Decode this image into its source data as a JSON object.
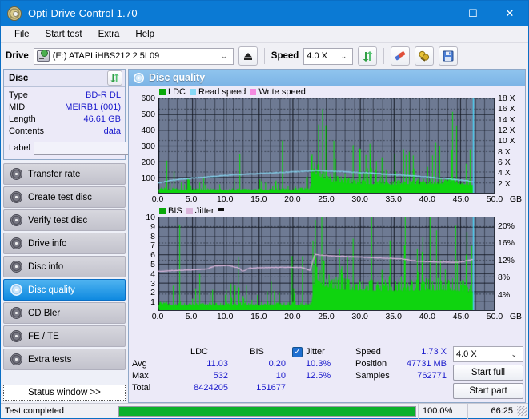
{
  "window": {
    "title": "Opti Drive Control 1.70",
    "icon": "disc-icon",
    "minimize": "—",
    "maximize": "☐",
    "close": "✕"
  },
  "menu": {
    "items": [
      {
        "label": "File",
        "accel": "F"
      },
      {
        "label": "Start test",
        "accel": "S"
      },
      {
        "label": "Extra",
        "accel": "x"
      },
      {
        "label": "Help",
        "accel": "H"
      }
    ]
  },
  "toolbar": {
    "drive_label": "Drive",
    "drive_value": "(E:)  ATAPI iHBS212  2 5L09",
    "eject_icon": "eject-icon",
    "speed_label": "Speed",
    "speed_value": "4.0 X",
    "refresh_icon": "refresh-icon",
    "eraser_icon": "eraser-icon",
    "clamp_icon": "clamp-icon",
    "save_icon": "save-icon",
    "chevron": "⌄"
  },
  "sidebar": {
    "disc_panel": {
      "title": "Disc",
      "refresh_icon": "refresh-icon",
      "rows": [
        {
          "key": "Type",
          "value": "BD-R DL"
        },
        {
          "key": "MID",
          "value": "MEIRB1 (001)"
        },
        {
          "key": "Length",
          "value": "46.61 GB"
        },
        {
          "key": "Contents",
          "value": "data"
        }
      ],
      "label_key": "Label",
      "label_value": "",
      "label_placeholder": "",
      "cd_icon": "cd-icon"
    },
    "nav": [
      {
        "label": "Transfer rate",
        "icon": "disc-icon",
        "active": false
      },
      {
        "label": "Create test disc",
        "icon": "disc-icon",
        "active": false
      },
      {
        "label": "Verify test disc",
        "icon": "disc-icon",
        "active": false
      },
      {
        "label": "Drive info",
        "icon": "disc-icon",
        "active": false
      },
      {
        "label": "Disc info",
        "icon": "disc-icon",
        "active": false
      },
      {
        "label": "Disc quality",
        "icon": "disc-icon",
        "active": true
      },
      {
        "label": "CD Bler",
        "icon": "disc-icon",
        "active": false
      },
      {
        "label": "FE / TE",
        "icon": "disc-icon",
        "active": false
      },
      {
        "label": "Extra tests",
        "icon": "disc-icon",
        "active": false
      }
    ],
    "status_window_button": "Status window >>"
  },
  "main": {
    "title": "Disc quality",
    "title_icon": "disc-icon"
  },
  "stats": {
    "col_headers": [
      "LDC",
      "BIS"
    ],
    "rows": [
      {
        "label": "Avg",
        "ldc": "11.03",
        "bis": "0.20"
      },
      {
        "label": "Max",
        "ldc": "532",
        "bis": "10"
      },
      {
        "label": "Total",
        "ldc": "8424205",
        "bis": "151677"
      }
    ],
    "jitter": {
      "checked": true,
      "check_glyph": "✓",
      "label": "Jitter",
      "values": [
        "10.3%",
        "12.5%"
      ]
    },
    "info": [
      {
        "key": "Speed",
        "value": "1.73 X"
      },
      {
        "key": "Position",
        "value": "47731 MB"
      },
      {
        "key": "Samples",
        "value": "762771"
      }
    ],
    "speed_select": "4.0 X",
    "speed_chevron": "⌄",
    "start_full_button": "Start full",
    "start_part_button": "Start part"
  },
  "statusbar": {
    "text": "Test completed",
    "progress_percent": 100.0,
    "progress_label": "100.0%",
    "elapsed": "66:25",
    "progress_color": "#0ab02a"
  },
  "colors": {
    "accent": "#0b7ad4",
    "plot_bg": "#6e7a93",
    "ldc_green": "#0fd40f",
    "read_speed": "#87d9f5",
    "write_speed": "#f58ae0",
    "jitter_pink": "#dcb6dc",
    "value_blue": "#1a1acc"
  },
  "chart_data": [
    {
      "type": "bar",
      "name": "ldc-chart",
      "title": "",
      "xlabel": "GB",
      "ylabel": "LDC",
      "xlim": [
        0,
        50
      ],
      "ylim": [
        0,
        600
      ],
      "y2lim": [
        0,
        18
      ],
      "y2label": "X",
      "grid": true,
      "legend": [
        {
          "label": "LDC",
          "color": "#0aa80a",
          "type": "bar"
        },
        {
          "label": "Read speed",
          "color": "#87d9f5",
          "type": "line"
        },
        {
          "label": "Write speed",
          "color": "#f58ae0",
          "type": "line"
        }
      ],
      "xticks": [
        "0.0",
        "5.0",
        "10.0",
        "15.0",
        "20.0",
        "25.0",
        "30.0",
        "35.0",
        "40.0",
        "45.0",
        "50.0"
      ],
      "yticks": [
        "100",
        "200",
        "300",
        "400",
        "500",
        "600"
      ],
      "y2ticks": [
        "2 X",
        "4 X",
        "6 X",
        "8 X",
        "10 X",
        "12 X",
        "14 X",
        "16 X",
        "18 X"
      ],
      "data_end_x": 46.8,
      "series": [
        {
          "name": "LDC",
          "color": "#0fd40f",
          "type": "bar",
          "x_start": 0.1,
          "x_end": 46.8,
          "baseline": [
            {
              "x": 0.1,
              "y": 35
            },
            {
              "x": 3,
              "y": 30
            },
            {
              "x": 8,
              "y": 28
            },
            {
              "x": 14,
              "y": 26
            },
            {
              "x": 20,
              "y": 30
            },
            {
              "x": 22.5,
              "y": 35
            },
            {
              "x": 23.2,
              "y": 200
            },
            {
              "x": 24.5,
              "y": 150
            },
            {
              "x": 26,
              "y": 110
            },
            {
              "x": 30,
              "y": 90
            },
            {
              "x": 35,
              "y": 85
            },
            {
              "x": 40,
              "y": 90
            },
            {
              "x": 44,
              "y": 95
            },
            {
              "x": 46.8,
              "y": 80
            }
          ],
          "spike_density": 0.55,
          "peak_max": 532
        },
        {
          "name": "Read speed",
          "color": "#87d9f5",
          "type": "line",
          "points": [
            {
              "x": 0.2,
              "y2": 1.9
            },
            {
              "x": 2,
              "y2": 2.4
            },
            {
              "x": 5,
              "y2": 2.8
            },
            {
              "x": 8,
              "y2": 3.1
            },
            {
              "x": 11,
              "y2": 3.4
            },
            {
              "x": 14,
              "y2": 3.6
            },
            {
              "x": 17,
              "y2": 3.8
            },
            {
              "x": 20,
              "y2": 4.0
            },
            {
              "x": 22.5,
              "y2": 4.15
            },
            {
              "x": 23.2,
              "y2": 4.3
            },
            {
              "x": 25,
              "y2": 4.2
            },
            {
              "x": 28,
              "y2": 4.0
            },
            {
              "x": 31,
              "y2": 3.8
            },
            {
              "x": 34,
              "y2": 3.55
            },
            {
              "x": 37,
              "y2": 3.3
            },
            {
              "x": 40,
              "y2": 3.0
            },
            {
              "x": 43,
              "y2": 2.7
            },
            {
              "x": 46,
              "y2": 2.3
            },
            {
              "x": 46.8,
              "y2": 2.1
            }
          ]
        },
        {
          "name": "Write speed",
          "color": "#f58ae0",
          "type": "line",
          "points": []
        }
      ],
      "cursor_x": 46.9
    },
    {
      "type": "bar",
      "name": "bis-chart",
      "title": "",
      "xlabel": "GB",
      "ylabel": "BIS",
      "xlim": [
        0,
        50
      ],
      "ylim": [
        0,
        10
      ],
      "y2lim": [
        0,
        22
      ],
      "y2label": "%",
      "grid": true,
      "legend": [
        {
          "label": "BIS",
          "color": "#0aa80a",
          "type": "bar"
        },
        {
          "label": "Jitter",
          "color": "#dcb6dc",
          "type": "line"
        }
      ],
      "xticks": [
        "0.0",
        "5.0",
        "10.0",
        "15.0",
        "20.0",
        "25.0",
        "30.0",
        "35.0",
        "40.0",
        "45.0",
        "50.0"
      ],
      "yticks": [
        "1",
        "2",
        "3",
        "4",
        "5",
        "6",
        "7",
        "8",
        "9",
        "10"
      ],
      "y2ticks": [
        "4%",
        "8%",
        "12%",
        "16%",
        "20%"
      ],
      "data_end_x": 46.8,
      "series": [
        {
          "name": "BIS",
          "color": "#0fd40f",
          "type": "bar",
          "x_start": 0.1,
          "x_end": 46.8,
          "baseline": [
            {
              "x": 0.1,
              "y": 0.9
            },
            {
              "x": 5,
              "y": 0.85
            },
            {
              "x": 12,
              "y": 0.85
            },
            {
              "x": 20,
              "y": 0.9
            },
            {
              "x": 22.8,
              "y": 1.0
            },
            {
              "x": 23.3,
              "y": 6.0
            },
            {
              "x": 24.5,
              "y": 4.2
            },
            {
              "x": 27,
              "y": 3.6
            },
            {
              "x": 32,
              "y": 3.4
            },
            {
              "x": 38,
              "y": 3.4
            },
            {
              "x": 43,
              "y": 3.5
            },
            {
              "x": 46.8,
              "y": 3.2
            }
          ],
          "spike_density": 0.45,
          "peak_max": 10
        },
        {
          "name": "Jitter",
          "color": "#dcb6dc",
          "type": "line",
          "points": [
            {
              "x": 0.2,
              "y2": 9.2
            },
            {
              "x": 1.5,
              "y2": 9.4
            },
            {
              "x": 4,
              "y2": 9.5
            },
            {
              "x": 7,
              "y2": 9.7
            },
            {
              "x": 8.5,
              "y2": 10.5
            },
            {
              "x": 10.5,
              "y2": 10.6
            },
            {
              "x": 12,
              "y2": 10.0
            },
            {
              "x": 12.6,
              "y2": 9.2
            },
            {
              "x": 13.5,
              "y2": 10.0
            },
            {
              "x": 16,
              "y2": 10.1
            },
            {
              "x": 19,
              "y2": 10.2
            },
            {
              "x": 21.5,
              "y2": 10.1
            },
            {
              "x": 22.6,
              "y2": 9.4
            },
            {
              "x": 23.3,
              "y2": 13.2
            },
            {
              "x": 24.5,
              "y2": 13.0
            },
            {
              "x": 27,
              "y2": 12.8
            },
            {
              "x": 30,
              "y2": 12.6
            },
            {
              "x": 33,
              "y2": 12.4
            },
            {
              "x": 36,
              "y2": 12.2
            },
            {
              "x": 39,
              "y2": 11.6
            },
            {
              "x": 42,
              "y2": 11.4
            },
            {
              "x": 45,
              "y2": 11.4
            },
            {
              "x": 46.8,
              "y2": 12.0
            }
          ]
        }
      ],
      "cursor_x": 46.9
    }
  ]
}
